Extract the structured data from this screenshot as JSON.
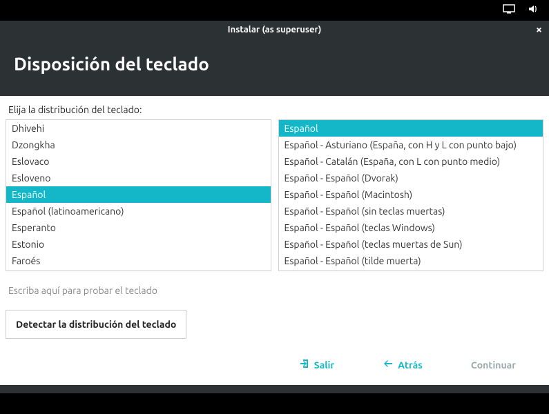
{
  "topbar": {
    "display_icon": "display",
    "volume_icon": "volume"
  },
  "window": {
    "title": "Instalar (as superuser)",
    "close": "×"
  },
  "header": {
    "title": "Disposición del teclado"
  },
  "prompt": "Elija la distribución del teclado:",
  "layouts": {
    "selected_index": 4,
    "items": [
      "Dhivehi",
      "Dzongkha",
      "Eslovaco",
      "Esloveno",
      "Español",
      "Español (latinoamericano)",
      "Esperanto",
      "Estonio",
      "Faroés"
    ]
  },
  "variants": {
    "selected_index": 0,
    "items": [
      "Español",
      "Español - Asturiano (España, con H y L con punto bajo)",
      "Español - Catalán (España, con L con punto medio)",
      "Español - Español (Dvorak)",
      "Español - Español (Macintosh)",
      "Español - Español (sin teclas muertas)",
      "Español - Español (teclas Windows)",
      "Español - Español (teclas muertas de Sun)",
      "Español - Español (tilde muerta)"
    ]
  },
  "test_input": {
    "placeholder": "Escriba aquí para probar el teclado",
    "value": ""
  },
  "detect_button": "Detectar la distribución del teclado",
  "footer": {
    "quit": "Salir",
    "back": "Atrás",
    "continue": "Continuar"
  }
}
